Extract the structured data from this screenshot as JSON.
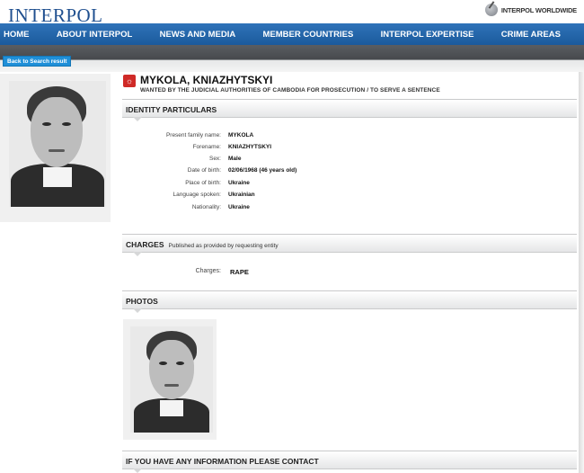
{
  "header": {
    "logo": "INTERPOL",
    "worldwide": "INTERPOL WORLDWIDE"
  },
  "nav": [
    {
      "label": "HOME"
    },
    {
      "label": "ABOUT INTERPOL"
    },
    {
      "label": "NEWS AND MEDIA"
    },
    {
      "label": "MEMBER COUNTRIES"
    },
    {
      "label": "INTERPOL EXPERTISE"
    },
    {
      "label": "CRIME AREAS"
    }
  ],
  "back_button": "Back to Search result",
  "person": {
    "name": "MYKOLA, KNIAZHYTSKYI",
    "wanted_text": "WANTED BY THE JUDICIAL AUTHORITIES OF CAMBODIA FOR PROSECUTION / TO SERVE A SENTENCE"
  },
  "identity": {
    "heading": "IDENTITY PARTICULARS",
    "rows": [
      {
        "label": "Present family name:",
        "value": "MYKOLA"
      },
      {
        "label": "Forename:",
        "value": "KNIAZHYTSKYI"
      },
      {
        "label": "Sex:",
        "value": "Male"
      },
      {
        "label": "Date of birth:",
        "value": "02/06/1968 (46 years old)"
      },
      {
        "label": "Place of birth:",
        "value": "Ukraine"
      },
      {
        "label": "Language spoken:",
        "value": "Ukrainian"
      },
      {
        "label": "Nationality:",
        "value": "Ukraine"
      }
    ]
  },
  "charges": {
    "heading": "CHARGES",
    "subheading": "Published as provided by requesting entity",
    "label": "Charges:",
    "value": "RAPE"
  },
  "photos": {
    "heading": "PHOTOS"
  },
  "contact": {
    "heading": "IF YOU HAVE ANY INFORMATION PLEASE CONTACT"
  },
  "colors": {
    "nav_blue": "#1f63a8",
    "button_blue": "#1f8fd8",
    "logo_blue": "#1f4f8f",
    "alert_red": "#cf2a27"
  }
}
